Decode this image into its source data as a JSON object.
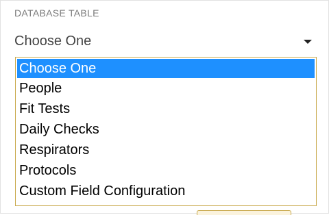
{
  "field": {
    "label": "DATABASE TABLE",
    "selected_value": "Choose One"
  },
  "dropdown": {
    "options": [
      {
        "label": "Choose One",
        "selected": true
      },
      {
        "label": "People",
        "selected": false
      },
      {
        "label": "Fit Tests",
        "selected": false
      },
      {
        "label": "Daily Checks",
        "selected": false
      },
      {
        "label": "Respirators",
        "selected": false
      },
      {
        "label": "Protocols",
        "selected": false
      },
      {
        "label": "Custom Field Configuration",
        "selected": false
      }
    ]
  },
  "icons": {
    "chevron": "chevron-down-icon"
  },
  "colors": {
    "highlight": "#1e90ff",
    "dropdown_border": "#c9a94c",
    "label_text": "#7a7a7a"
  }
}
